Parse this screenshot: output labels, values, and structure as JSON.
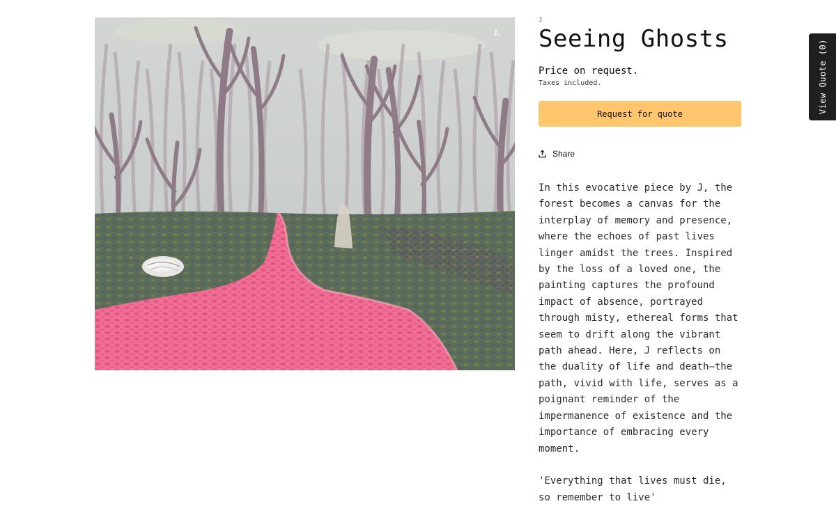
{
  "product": {
    "vendor": "J",
    "title": "Seeing Ghosts",
    "price": "Price on request.",
    "tax_note": "Taxes included.",
    "image_signature": "J.",
    "artwork": {
      "sky": "#d6d9d8",
      "ground": "#5a6b5c",
      "path": "#f26e94",
      "path_dots": "#d94f7c",
      "trees": "#8f7a87",
      "moss": "#7a8a3c"
    }
  },
  "actions": {
    "quote_label": "Request for quote",
    "quote_color": "#ffc66d",
    "share_label": "Share"
  },
  "description": {
    "paragraph": "In this evocative piece by J, the forest becomes a canvas for the interplay of memory and presence, where the echoes of past lives linger amidst the trees. Inspired by the loss of a loved one, the painting captures the profound impact of absence, portrayed through misty, ethereal forms that seem to drift along the vibrant path ahead. Here, J reflects on the duality of life and death—the path, vivid with life, serves as a poignant reminder of the impermanence of existence and the importance of embracing every moment.",
    "quote": "'Everything that lives must die, so remember to live'"
  },
  "quote_tab": {
    "label": "View Quote (0)"
  }
}
